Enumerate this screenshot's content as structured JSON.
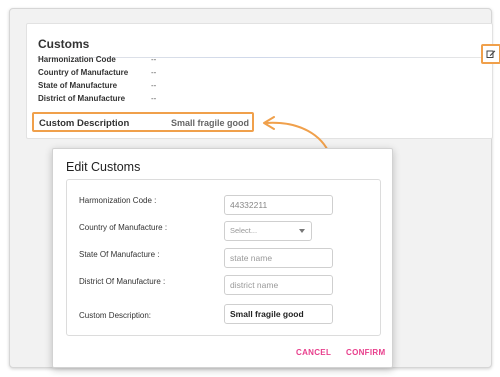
{
  "card": {
    "title": "Customs",
    "fields": [
      {
        "label": "Harmonization Code",
        "value": "--"
      },
      {
        "label": "Country of Manufacture",
        "value": "--"
      },
      {
        "label": "State of Manufacture",
        "value": "--"
      },
      {
        "label": "District of Manufacture",
        "value": "--"
      }
    ],
    "custom_description": {
      "label": "Custom Description",
      "value": "Small fragile good"
    },
    "edit_icon": "edit-icon"
  },
  "modal": {
    "title": "Edit Customs",
    "harmonization": {
      "label": "Harmonization Code :",
      "value": "44332211"
    },
    "country": {
      "label": "Country of Manufacture :",
      "placeholder": "Select..."
    },
    "state": {
      "label": "State Of Manufacture :",
      "placeholder": "state name"
    },
    "district": {
      "label": "District Of Manufacture :",
      "placeholder": "district name"
    },
    "description": {
      "label": "Custom Description:",
      "value": "Small fragile good"
    },
    "cancel_label": "CANCEL",
    "confirm_label": "CONFIRM"
  },
  "colors": {
    "highlight": "#f0a04b",
    "action": "#e83e8c"
  }
}
